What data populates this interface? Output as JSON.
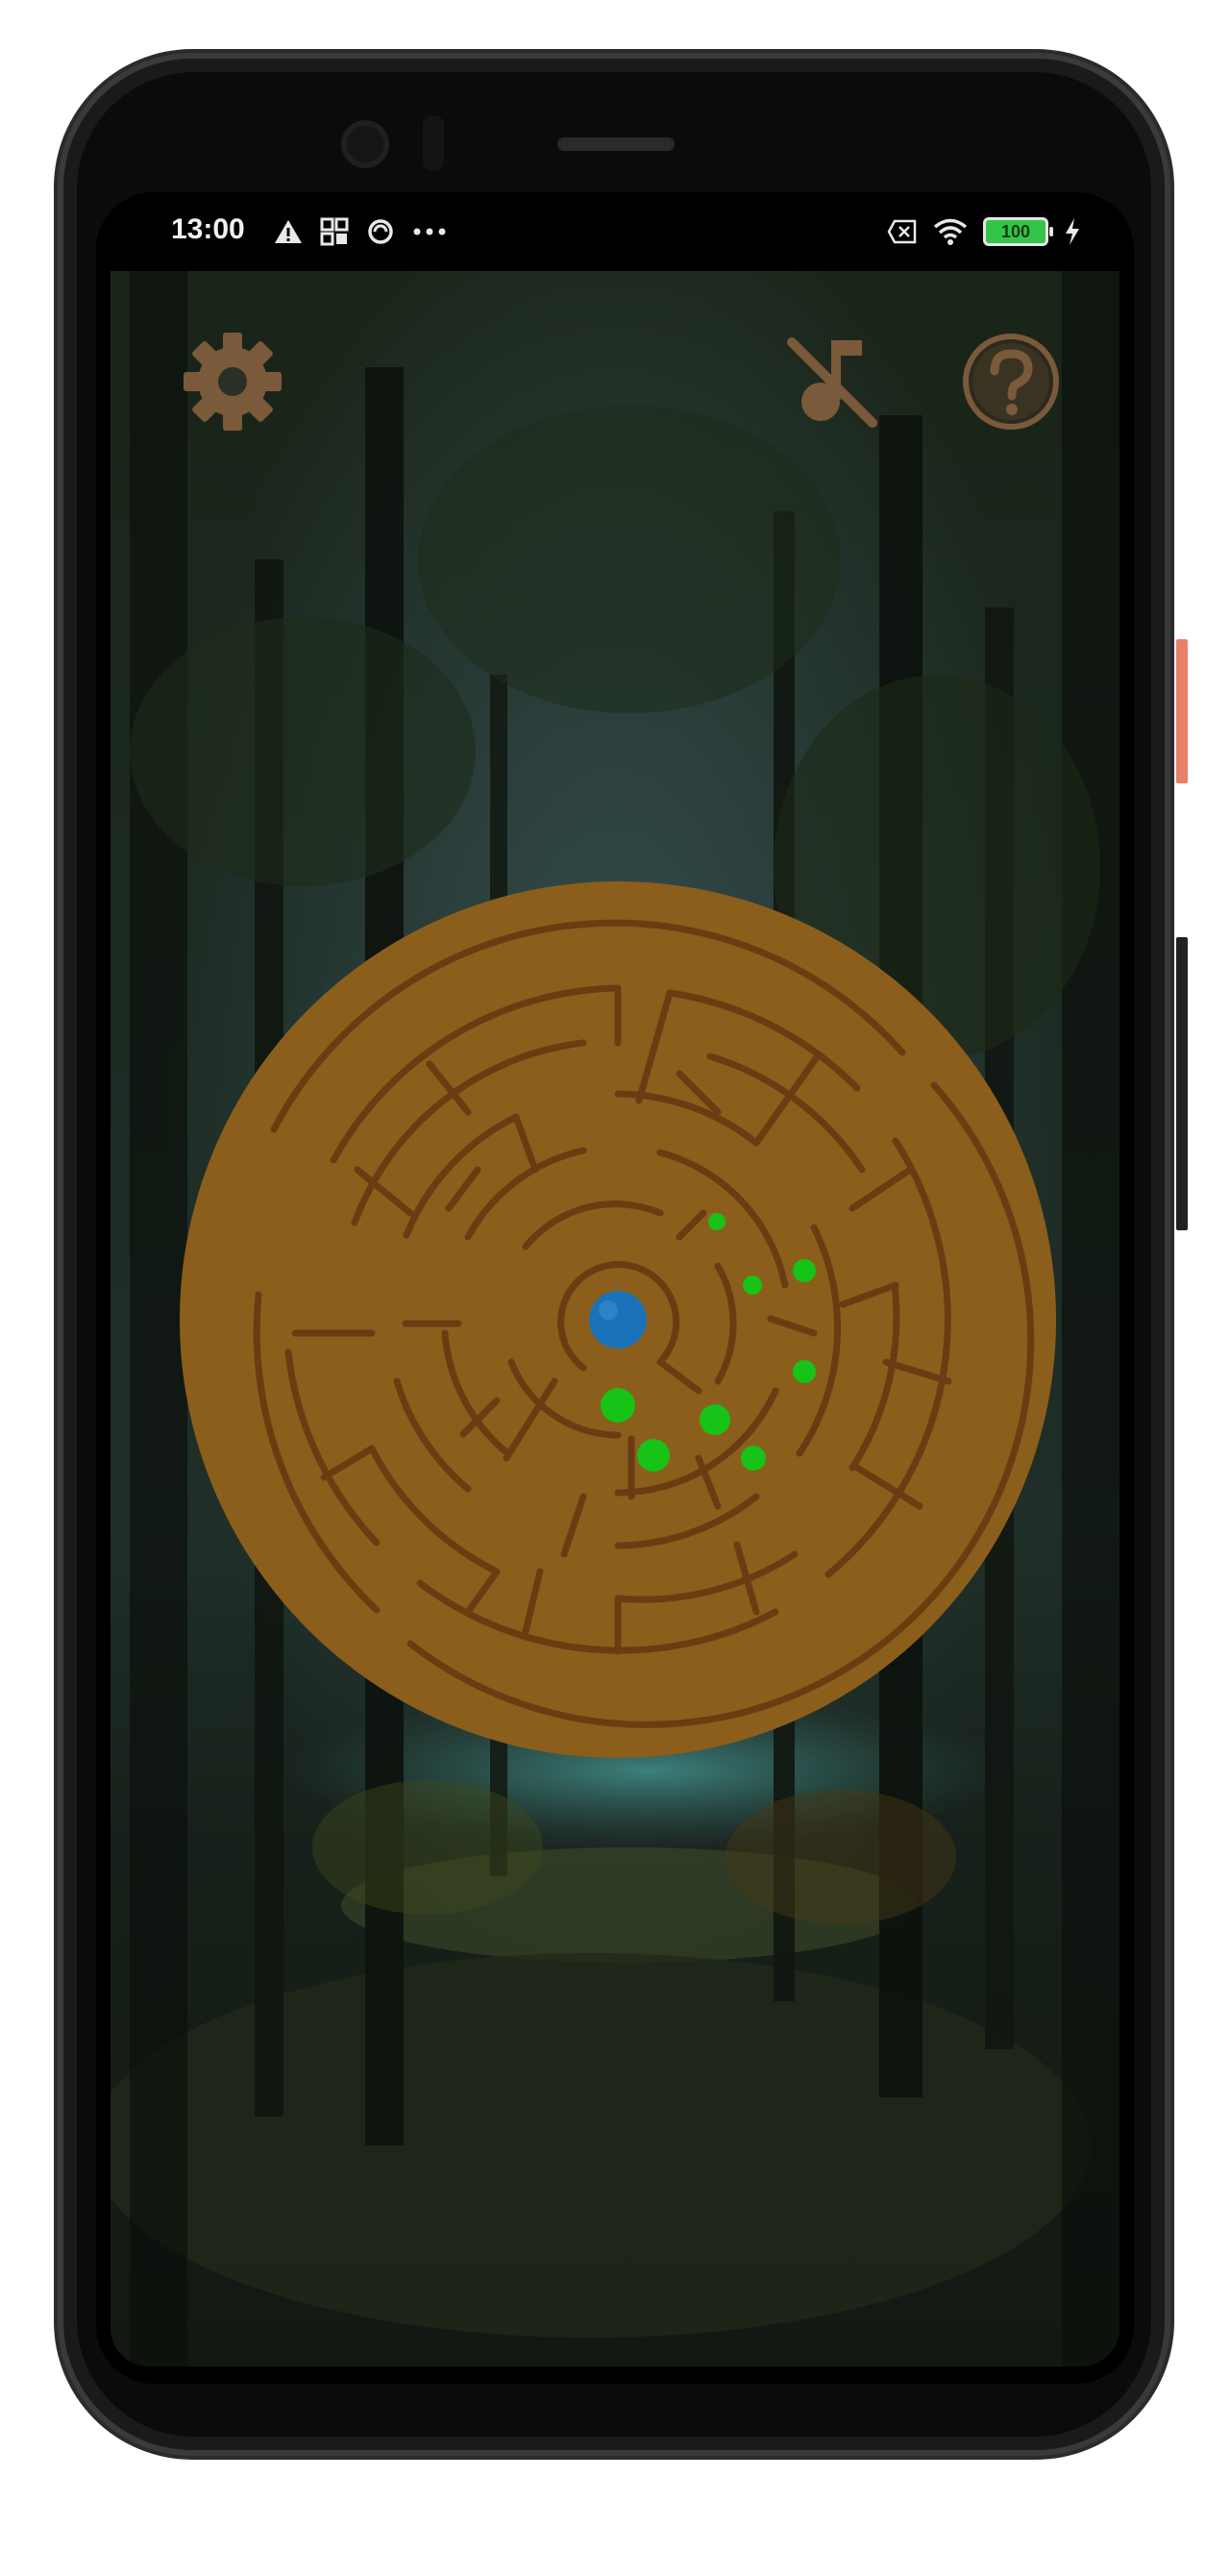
{
  "status_bar": {
    "time": "13:00",
    "left_icons": [
      "warning-icon",
      "qr-grid-icon",
      "data-saver-icon",
      "more-dots-icon"
    ],
    "right_icons": [
      "no-sim-icon",
      "wifi-icon",
      "battery-icon",
      "charging-icon"
    ],
    "battery_level": "100"
  },
  "toolbar": {
    "settings_icon": "gear-icon",
    "music_icon": "music-off-icon",
    "help_icon": "help-icon"
  },
  "colors": {
    "maze_fill": "#8b5e1c",
    "maze_wall": "#6a3c12",
    "icon_tint": "#7a5a3a",
    "ball": "#1a72b8",
    "collectible": "#16c316"
  }
}
